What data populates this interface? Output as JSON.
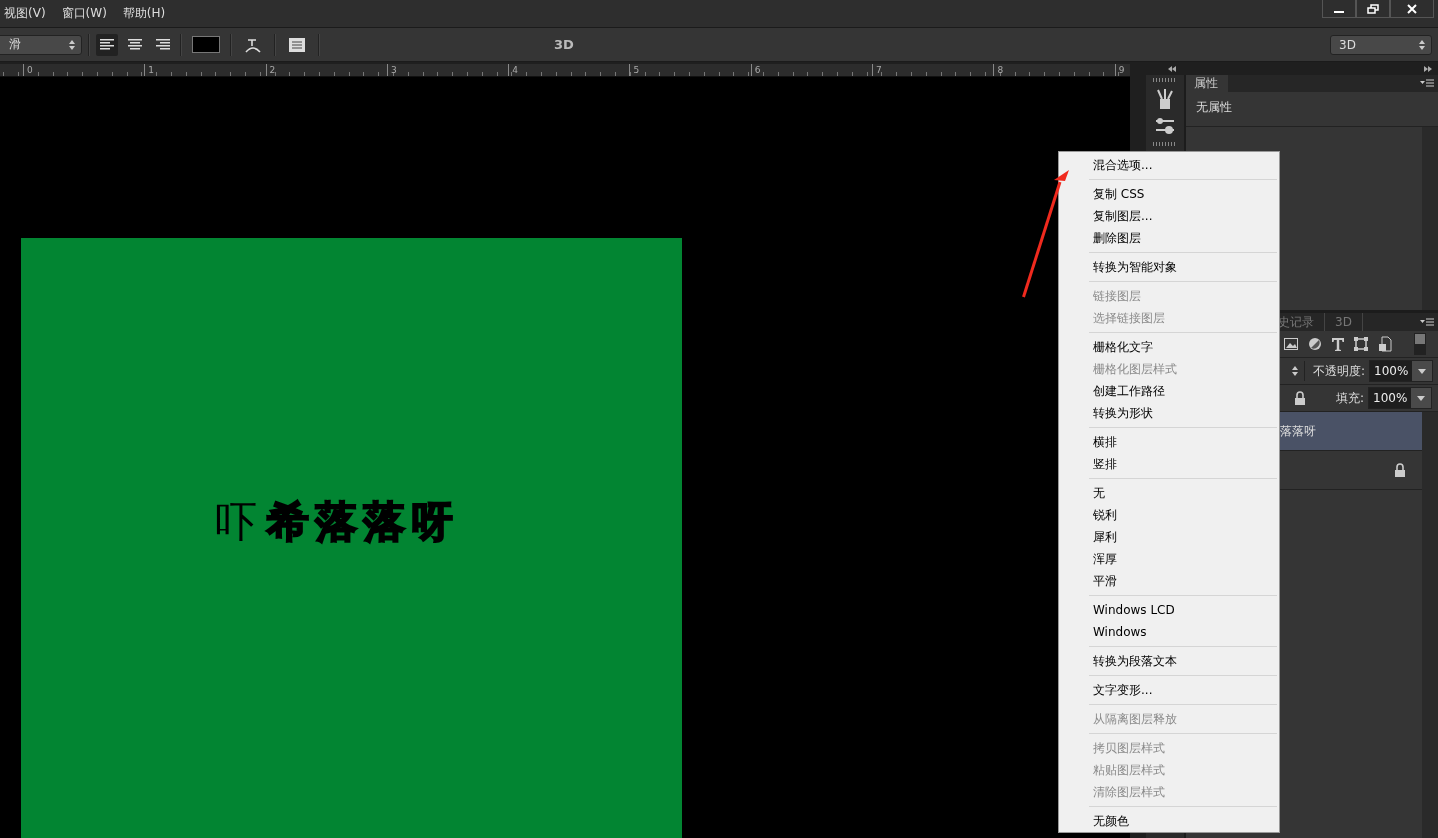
{
  "menubar": [
    "视图(V)",
    "窗口(W)",
    "帮助(H)"
  ],
  "options_bar": {
    "antialias": "滑",
    "align": [
      {
        "selected": true
      },
      {
        "selected": false
      },
      {
        "selected": false
      }
    ],
    "mode_label": "3D",
    "workspace": "3D"
  },
  "ruler": [
    "0",
    "1",
    "2",
    "3",
    "4",
    "5",
    "6",
    "7",
    "8",
    "9"
  ],
  "canvas": {
    "text": "吓**希落落呀**"
  },
  "properties": {
    "tab": "属性",
    "body": "无属性"
  },
  "layers_panel": {
    "tabs": [
      {
        "label": "史记录",
        "selected": false
      },
      {
        "label": "3D",
        "selected": false
      }
    ],
    "opacity_label": "不透明度:",
    "opacity": "100%",
    "fill_label": "填充:",
    "fill": "100%",
    "layers": [
      {
        "name": "落落呀",
        "selected": true,
        "locked": false
      },
      {
        "selected": false,
        "locked": true
      }
    ]
  },
  "context_menu": [
    [
      {
        "label": "混合选项...",
        "disabled": false
      }
    ],
    [
      {
        "label": "复制 CSS",
        "disabled": false
      },
      {
        "label": "复制图层...",
        "disabled": false
      },
      {
        "label": "删除图层",
        "disabled": false
      }
    ],
    [
      {
        "label": "转换为智能对象",
        "disabled": false
      }
    ],
    [
      {
        "label": "链接图层",
        "disabled": true
      },
      {
        "label": "选择链接图层",
        "disabled": true
      }
    ],
    [
      {
        "label": "栅格化文字",
        "disabled": false
      },
      {
        "label": "栅格化图层样式",
        "disabled": true
      },
      {
        "label": "创建工作路径",
        "disabled": false
      },
      {
        "label": "转换为形状",
        "disabled": false
      }
    ],
    [
      {
        "label": "横排",
        "disabled": false
      },
      {
        "label": "竖排",
        "disabled": false
      }
    ],
    [
      {
        "label": "无",
        "disabled": false
      },
      {
        "label": "锐利",
        "disabled": false
      },
      {
        "label": "犀利",
        "disabled": false
      },
      {
        "label": "浑厚",
        "disabled": false
      },
      {
        "label": "平滑",
        "disabled": false
      }
    ],
    [
      {
        "label": "Windows LCD",
        "disabled": false
      },
      {
        "label": "Windows",
        "disabled": false
      }
    ],
    [
      {
        "label": "转换为段落文本",
        "disabled": false
      }
    ],
    [
      {
        "label": "文字变形...",
        "disabled": false
      }
    ],
    [
      {
        "label": "从隔离图层释放",
        "disabled": true
      }
    ],
    [
      {
        "label": "拷贝图层样式",
        "disabled": true
      },
      {
        "label": "粘贴图层样式",
        "disabled": true
      },
      {
        "label": "清除图层样式",
        "disabled": true
      }
    ],
    [
      {
        "label": "无颜色",
        "disabled": false
      }
    ]
  ]
}
